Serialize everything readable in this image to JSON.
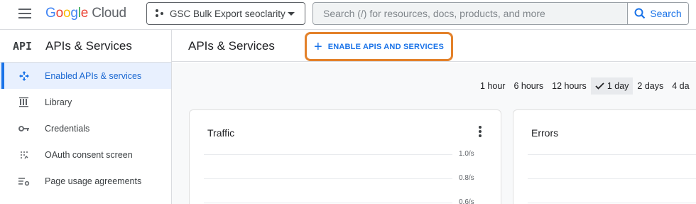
{
  "header": {
    "logo_google": [
      "G",
      "o",
      "o",
      "g",
      "l",
      "e"
    ],
    "logo_cloud": "Cloud",
    "project_name": "GSC Bulk Export seoclarity",
    "search_placeholder": "Search (/) for resources, docs, products, and more",
    "search_button": "Search"
  },
  "sidebar": {
    "badge": "API",
    "title": "APIs & Services",
    "items": [
      {
        "label": "Enabled APIs & services",
        "icon": "move-arrows-icon",
        "active": true
      },
      {
        "label": "Library",
        "icon": "library-icon",
        "active": false
      },
      {
        "label": "Credentials",
        "icon": "key-icon",
        "active": false
      },
      {
        "label": "OAuth consent screen",
        "icon": "oauth-icon",
        "active": false
      },
      {
        "label": "Page usage agreements",
        "icon": "settings-list-icon",
        "active": false
      }
    ]
  },
  "main": {
    "title": "APIs & Services",
    "enable_button": "ENABLE APIS AND SERVICES",
    "time_ranges": [
      "1 hour",
      "6 hours",
      "12 hours",
      "1 day",
      "2 days",
      "4 da"
    ],
    "selected_range": "1 day",
    "cards": {
      "traffic": {
        "title": "Traffic",
        "y_ticks": [
          "1.0/s",
          "0.8/s",
          "0.6/s"
        ]
      },
      "errors": {
        "title": "Errors"
      }
    }
  },
  "colors": {
    "accent": "#1a73e8",
    "highlight_outline": "#e3812a",
    "active_nav_bg": "#e8f0fe"
  }
}
